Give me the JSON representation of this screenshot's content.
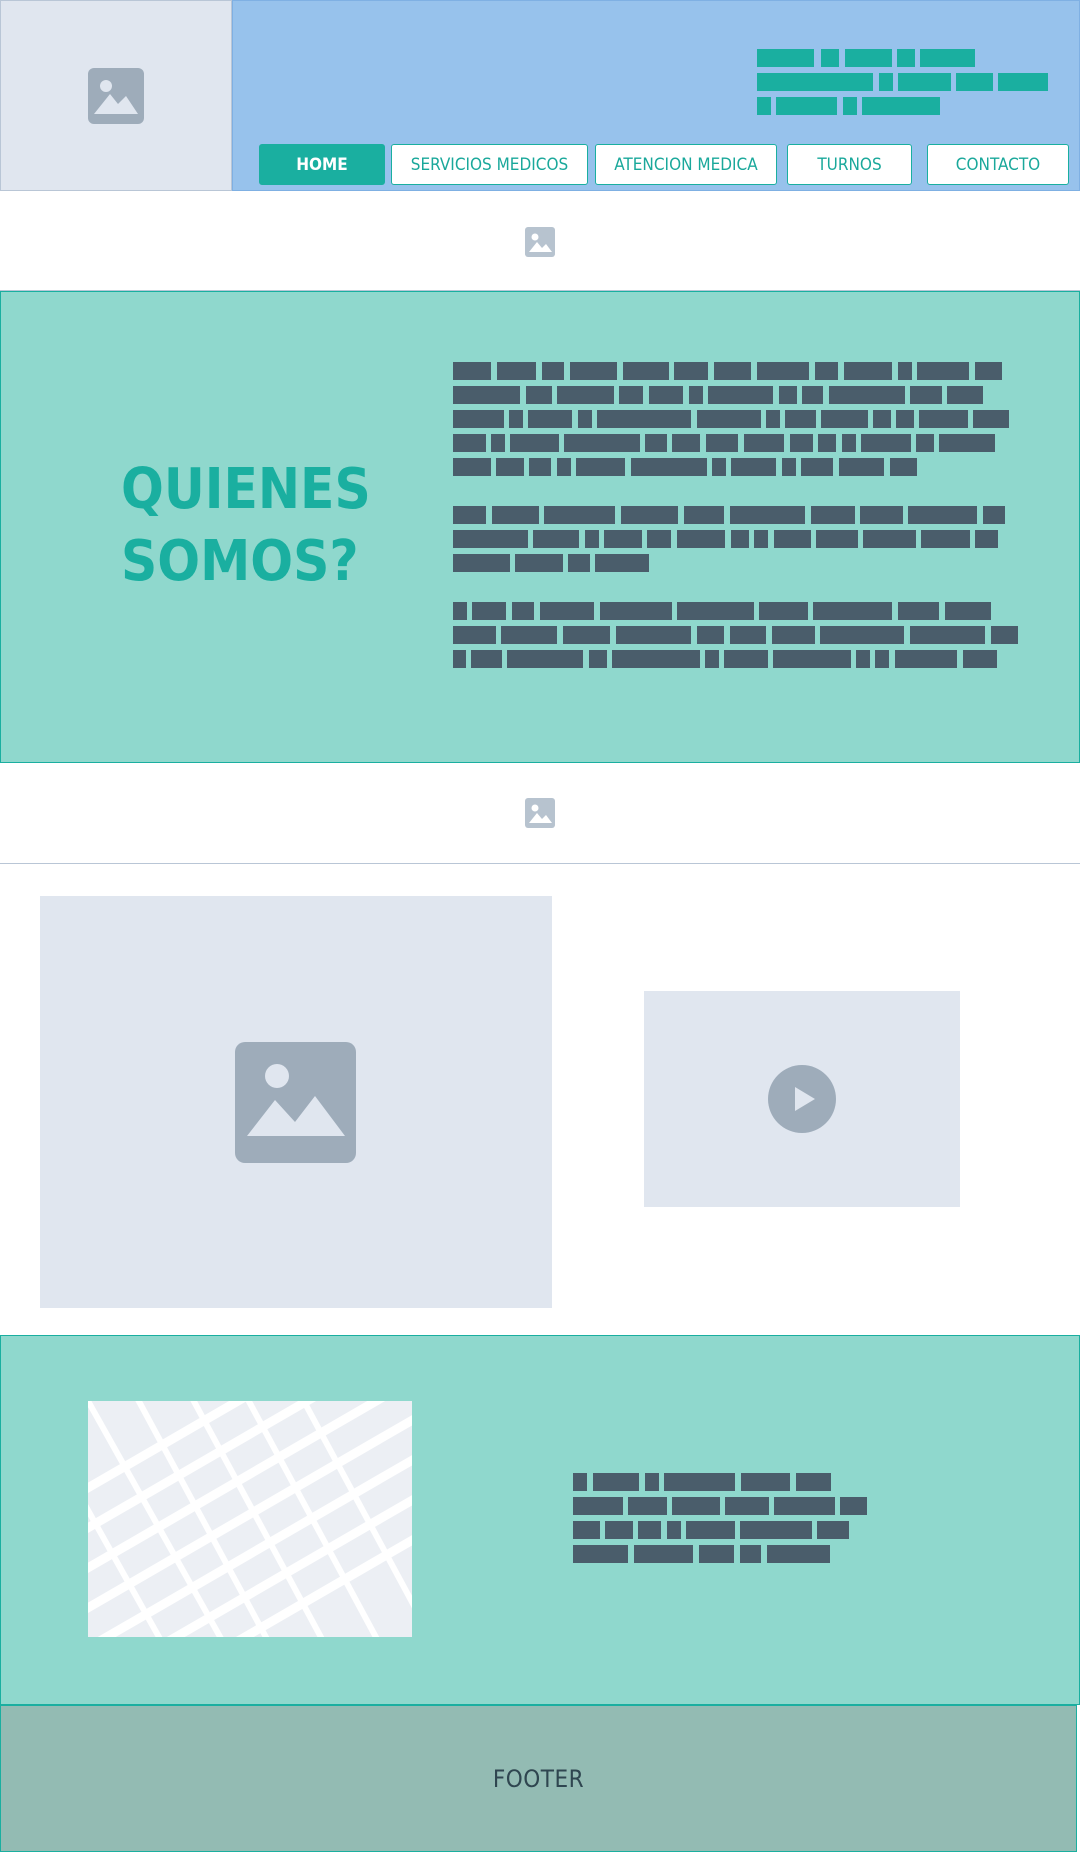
{
  "header": {
    "logo_icon": "image-placeholder-icon",
    "nav": [
      {
        "label": "HOME",
        "active": true
      },
      {
        "label": "SERVICIOS MEDICOS",
        "active": false
      },
      {
        "label": "ATENCION MEDICA",
        "active": false
      },
      {
        "label": "TURNOS",
        "active": false
      },
      {
        "label": "CONTACTO",
        "active": false
      }
    ]
  },
  "banners": {
    "top_icon": "image-placeholder-icon",
    "middle_icon": "image-placeholder-icon"
  },
  "about": {
    "title_line1": "QUIENES",
    "title_line2": "SOMOS?"
  },
  "media": {
    "image_icon": "image-placeholder-icon",
    "video_icon": "play-icon"
  },
  "contact": {
    "map_icon": "map-placeholder"
  },
  "footer": {
    "label": "FOOTER"
  },
  "colors": {
    "accent": "#1aafa0",
    "header_bg": "#97c2ec",
    "section_bg": "#8fd8cd",
    "footer_bg": "#93bbb3",
    "placeholder_bg": "#e0e6ef",
    "placeholder_icon": "#9eacba",
    "text_block": "#4a5d6b"
  }
}
